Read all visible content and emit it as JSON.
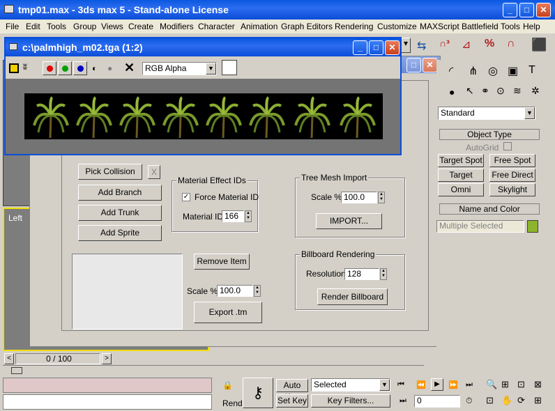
{
  "app": {
    "title": "tmp01.max - 3ds max 5 - Stand-alone License",
    "menu": [
      "File",
      "Edit",
      "Tools",
      "Group",
      "Views",
      "Create",
      "Modifiers",
      "Character",
      "Animation",
      "Graph Editors",
      "Rendering",
      "Customize",
      "MAXScript",
      "Battlefield Tools",
      "Help"
    ]
  },
  "image_window": {
    "title": "c:\\palmhigh_m02.tga (1:2)",
    "channel": "RGB Alpha",
    "colors": {
      "red": "#e00000",
      "green": "#00a000",
      "blue": "#0000c0"
    }
  },
  "tool_panel": {
    "pick_collision": "Pick Collision",
    "close_x": "X",
    "add_branch": "Add Branch",
    "add_trunk": "Add Trunk",
    "add_sprite": "Add Sprite",
    "material_group": "Material Effect IDs",
    "force_material": "Force Material ID",
    "material_id_label": "Material ID:",
    "material_id": "166",
    "remove_item": "Remove Item",
    "scale_label": "Scale %",
    "scale_value": "100.0",
    "export": "Export .tm",
    "tree_mesh_group": "Tree Mesh Import",
    "tree_scale_label": "Scale %",
    "tree_scale_value": "100.0",
    "import": "IMPORT...",
    "billboard_group": "Billboard Rendering",
    "resolution_label": "Resolution",
    "resolution_value": "128",
    "render_billboard": "Render Billboard"
  },
  "command_panel": {
    "dropdown": "Standard",
    "object_type": "Object Type",
    "autogrid": "AutoGrid",
    "buttons": [
      "Target Spot",
      "Free Spot",
      "Target Direct",
      "Free Direct",
      "Omni",
      "Skylight"
    ],
    "name_color": "Name and Color",
    "selection_name": "Multiple Selected",
    "swatch_color": "#8db42c"
  },
  "viewport": {
    "label": "Left"
  },
  "timeline": {
    "frame": "0 / 100"
  },
  "bottom": {
    "render_label": "Rende",
    "auto_key": "Auto Key",
    "set_key": "Set Key",
    "selected": "Selected",
    "key_filters": "Key Filters...",
    "frame_value": "0"
  }
}
